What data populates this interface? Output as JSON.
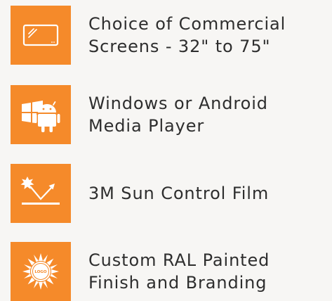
{
  "features": [
    {
      "icon": "commercial-screen-icon",
      "lines": [
        "Choice of Commercial",
        "Screens - 32\" to 75\""
      ]
    },
    {
      "icon": "windows-android-icon",
      "lines": [
        "Windows or Android",
        "Media Player"
      ]
    },
    {
      "icon": "sun-control-film-icon",
      "lines": [
        "3M Sun Control Film"
      ]
    },
    {
      "icon": "sun-logo-branding-icon",
      "lines": [
        "Custom RAL Painted",
        "Finish and Branding"
      ],
      "badge": "LOGO"
    }
  ],
  "colors": {
    "tile": "#f58a2a",
    "text": "#2e2e2e",
    "background": "#f7f6f4"
  }
}
